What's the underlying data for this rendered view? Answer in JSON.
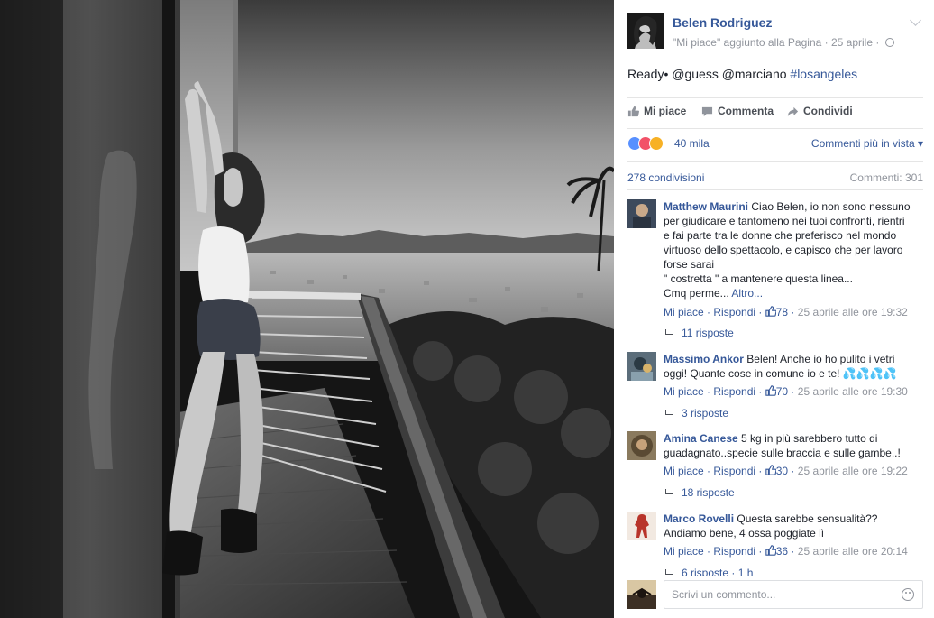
{
  "post": {
    "page_name": "Belen Rodriguez",
    "meta": "\"Mi piace\" aggiunto alla Pagina · 25 aprile ·",
    "text_plain": "Ready• @guess @marciano ",
    "hashtag": "#losangeles",
    "actions": {
      "like": "Mi piace",
      "comment": "Commenta",
      "share": "Condividi"
    },
    "reactions_count": "40 mila",
    "comment_order": "Commenti più in vista",
    "shares": "278 condivisioni",
    "comments_count": "Commenti: 301"
  },
  "comments": [
    {
      "author": "Matthew Maurini",
      "lines": [
        "Ciao Belen, io non sono nessuno",
        "per giudicare e tantomeno nei tuoi confronti, rientri",
        "e fai parte tra le donne che preferisco nel mondo",
        "virtuoso dello spettacolo, e capisco che per lavoro",
        "forse sarai",
        "\" costretta \" a mantenere questa linea...",
        "Cmq perme..."
      ],
      "more": "Altro...",
      "like": "Mi piace",
      "reply": "Rispondi",
      "likes": "78",
      "time": "25 aprile alle ore 19:32",
      "replies": "11 risposte"
    },
    {
      "author": "Massimo Ankor",
      "lines": [
        "Belen! Anche io ho pulito i vetri",
        "oggi! Quante cose in comune io e te! 💦💦💦💦"
      ],
      "like": "Mi piace",
      "reply": "Rispondi",
      "likes": "70",
      "time": "25 aprile alle ore 19:30",
      "replies": "3 risposte"
    },
    {
      "author": "Amina Canese",
      "lines": [
        "5 kg in più sarebbero tutto di",
        "guadagnato..specie sulle braccia e sulle gambe..!"
      ],
      "like": "Mi piace",
      "reply": "Rispondi",
      "likes": "30",
      "time": "25 aprile alle ore 19:22",
      "replies": "18 risposte"
    },
    {
      "author": "Marco Rovelli",
      "lines": [
        "Questa sarebbe sensualità??",
        "Andiamo bene, 4 ossa poggiate lì"
      ],
      "like": "Mi piace",
      "reply": "Rispondi",
      "likes": "36",
      "time": "25 aprile alle ore 20:14",
      "replies": "6 risposte · 1 h"
    }
  ],
  "compose": {
    "placeholder": "Scrivi un commento..."
  },
  "colors": {
    "link": "#365899",
    "meta": "#90949c",
    "action": "#4b4f56",
    "like_reaction": "#5890ff",
    "love_reaction": "#f25268",
    "wow_reaction": "#f7b125"
  },
  "icons": [
    "thumbs-up-icon",
    "comment-icon",
    "share-icon",
    "globe-icon",
    "chevron-down-icon",
    "reply-arrow-icon",
    "emoji-icon"
  ]
}
